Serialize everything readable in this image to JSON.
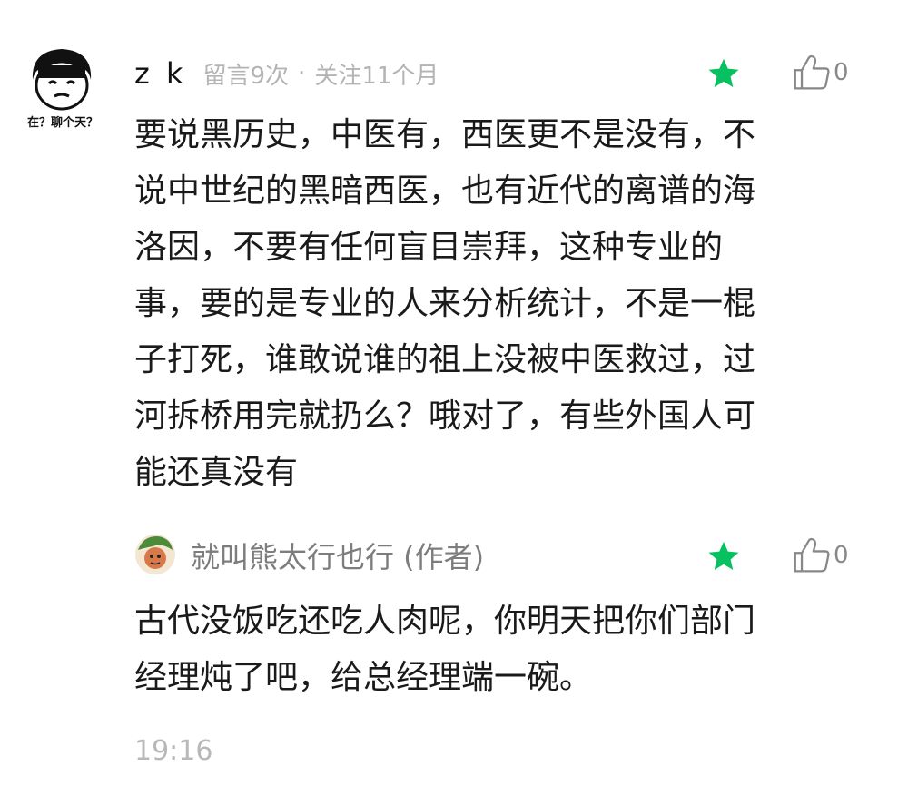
{
  "comment": {
    "avatar_caption": "在？聊个天？",
    "username": "z k",
    "message_count": "留言9次",
    "separator": "·",
    "follow_duration": "关注11个月",
    "likes": "0",
    "body_lines": [
      "要说黑历史，中医有，西医更不是没有，不",
      "说中世纪的黑暗西医，也有近代的离谱的海",
      "洛因，不要有任何盲目崇拜，这种专业的",
      "事，要的是专业的人来分析统计，不是一棍",
      "子打死，谁敢说谁的祖上没被中医救过，过",
      "河拆桥用完就扔么？哦对了，有些外国人可",
      "能还真没有"
    ]
  },
  "reply": {
    "author": "就叫熊太行也行 (作者)",
    "likes": "0",
    "body_lines": [
      "古代没饭吃还吃人肉呢，你明天把你们部门",
      "经理炖了吧，给总经理端一碗。"
    ]
  },
  "timestamp": "19:16",
  "colors": {
    "star": "#07c160",
    "meta": "#b4b4b4",
    "text": "#1a1a1a",
    "icon": "#888888"
  },
  "icons": {
    "featured": "star-icon",
    "like": "thumbs-up-icon",
    "avatar_main": "cartoon-face-avatar",
    "avatar_reply": "author-avatar"
  }
}
